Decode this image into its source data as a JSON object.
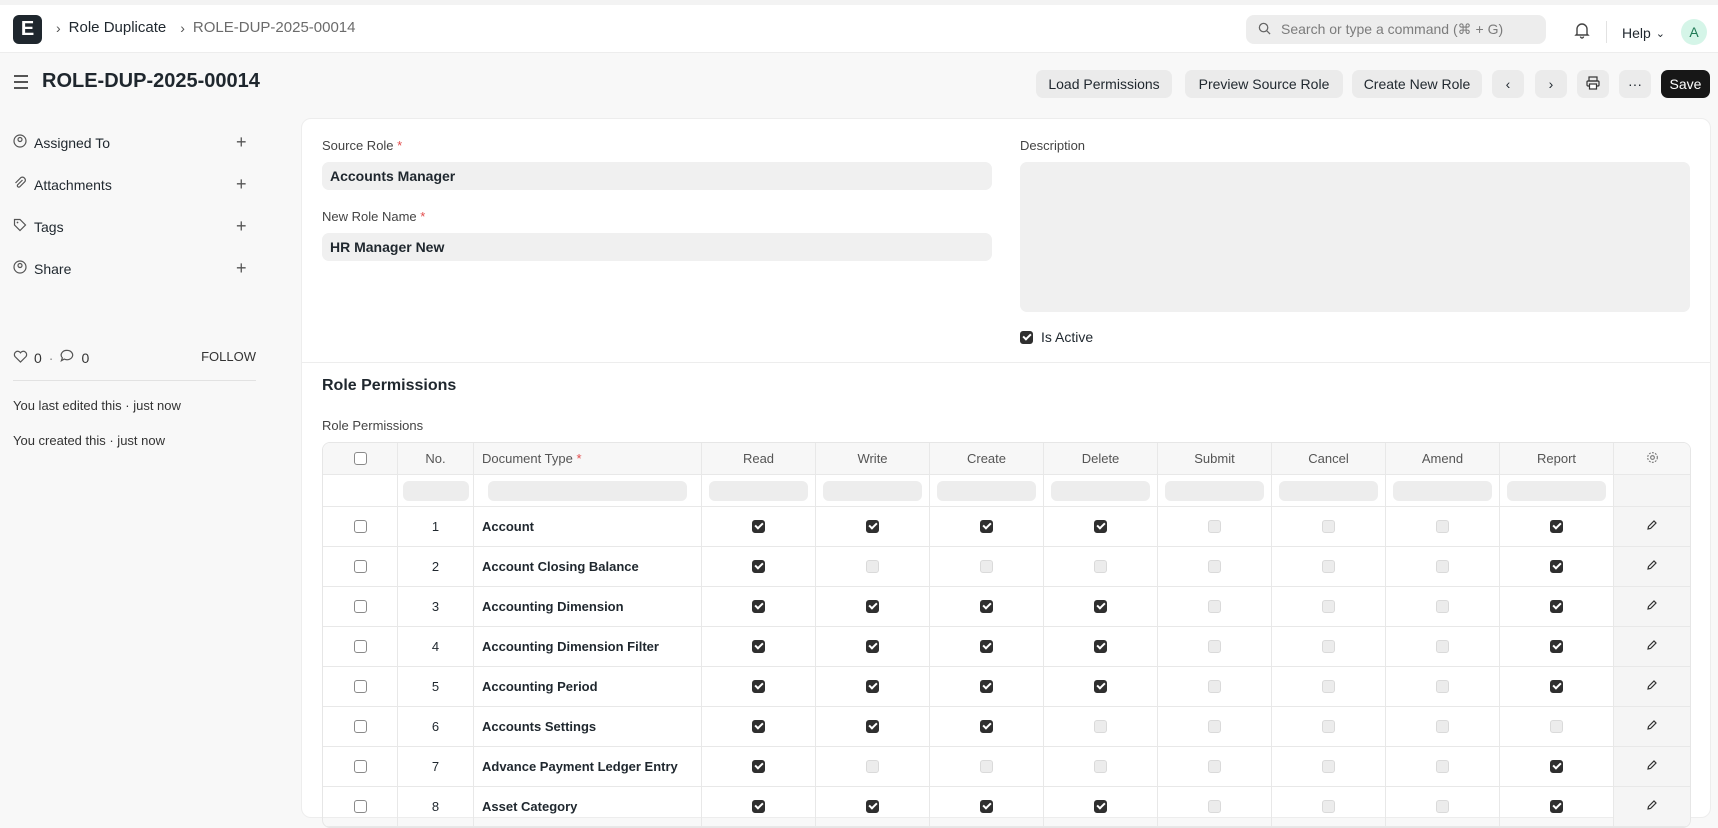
{
  "nav": {
    "logo": "E",
    "breadcrumbs": [
      "Role Duplicate",
      "ROLE-DUP-2025-00014"
    ],
    "search_placeholder": "Search or type a command (⌘ + G)",
    "help_label": "Help",
    "avatar_initial": "A"
  },
  "page": {
    "title": "ROLE-DUP-2025-00014",
    "buttons": {
      "load": "Load Permissions",
      "preview": "Preview Source Role",
      "create": "Create New Role",
      "save": "Save"
    }
  },
  "sidebar": {
    "items": [
      "Assigned To",
      "Attachments",
      "Tags",
      "Share"
    ],
    "likes": "0",
    "comments": "0",
    "follow": "FOLLOW",
    "last_edited": "You last edited this · just now",
    "created": "You created this · just now"
  },
  "form": {
    "source_role_label": "Source Role",
    "source_role_value": "Accounts Manager",
    "new_role_label": "New Role Name",
    "new_role_value": "HR Manager New",
    "description_label": "Description",
    "is_active_label": "Is Active",
    "is_active": true
  },
  "permissions": {
    "section_title": "Role Permissions",
    "table_label": "Role Permissions",
    "columns": [
      "No.",
      "Document Type",
      "Read",
      "Write",
      "Create",
      "Delete",
      "Submit",
      "Cancel",
      "Amend",
      "Report"
    ],
    "rows": [
      {
        "no": "1",
        "doc": "Account",
        "perms": [
          1,
          1,
          1,
          1,
          0,
          0,
          0,
          1
        ]
      },
      {
        "no": "2",
        "doc": "Account Closing Balance",
        "perms": [
          1,
          0,
          0,
          0,
          0,
          0,
          0,
          1
        ]
      },
      {
        "no": "3",
        "doc": "Accounting Dimension",
        "perms": [
          1,
          1,
          1,
          1,
          0,
          0,
          0,
          1
        ]
      },
      {
        "no": "4",
        "doc": "Accounting Dimension Filter",
        "perms": [
          1,
          1,
          1,
          1,
          0,
          0,
          0,
          1
        ]
      },
      {
        "no": "5",
        "doc": "Accounting Period",
        "perms": [
          1,
          1,
          1,
          1,
          0,
          0,
          0,
          1
        ]
      },
      {
        "no": "6",
        "doc": "Accounts Settings",
        "perms": [
          1,
          1,
          1,
          0,
          0,
          0,
          0,
          0
        ]
      },
      {
        "no": "7",
        "doc": "Advance Payment Ledger Entry",
        "perms": [
          1,
          0,
          0,
          0,
          0,
          0,
          0,
          1
        ]
      },
      {
        "no": "8",
        "doc": "Asset Category",
        "perms": [
          1,
          1,
          1,
          1,
          0,
          0,
          0,
          1
        ]
      }
    ]
  }
}
